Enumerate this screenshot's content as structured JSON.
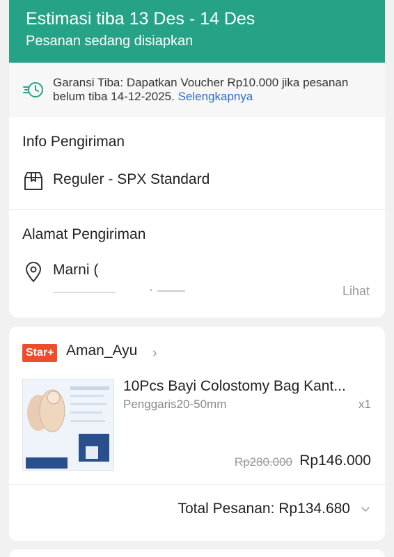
{
  "header": {
    "estimate": "Estimasi tiba 13 Des - 14 Des",
    "status": "Pesanan sedang disiapkan",
    "bg_color": "#26a386"
  },
  "guarantee": {
    "icon": "fast-delivery-clock-icon",
    "text": "Garansi Tiba: Dapatkan Voucher Rp10.000 jika pesanan belum tiba 14-12-2025.",
    "link": "Selengkapnya"
  },
  "shipping": {
    "title": "Info Pengiriman",
    "icon": "box-icon",
    "method": "Reguler - SPX Standard"
  },
  "address": {
    "title": "Alamat Pengiriman",
    "icon": "location-pin-icon",
    "name": "Marni (",
    "view_link": "Lihat"
  },
  "order": {
    "badge": "Star+",
    "shop_name": "Aman_Ayu",
    "product": {
      "name": "10Pcs Bayi Colostomy Bag Kant...",
      "variant": "Penggaris20-50mm",
      "qty": "x1",
      "original_price": "Rp280.000",
      "price": "Rp146.000",
      "thumb_label": "COLOSTOMY BAG",
      "thumb_count": "10 Pcs"
    },
    "total": "Total Pesanan: Rp134.680"
  }
}
